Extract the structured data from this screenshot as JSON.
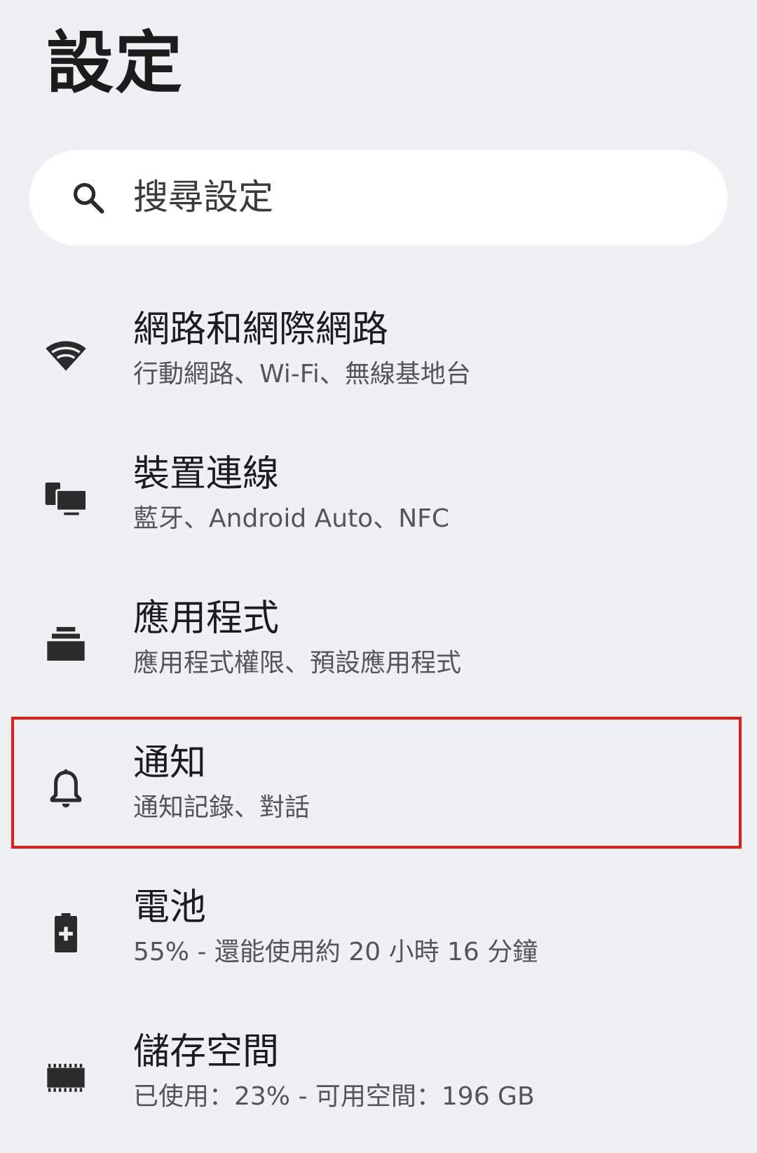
{
  "header": {
    "title": "設定"
  },
  "search": {
    "placeholder": "搜尋設定",
    "icon": "search-icon"
  },
  "settings": [
    {
      "id": "network",
      "icon": "wifi-icon",
      "title": "網路和網際網路",
      "summary": "行動網路、Wi-Fi、無線基地台"
    },
    {
      "id": "connected-devices",
      "icon": "devices-icon",
      "title": "裝置連線",
      "summary": "藍牙、Android Auto、NFC"
    },
    {
      "id": "apps",
      "icon": "apps-icon",
      "title": "應用程式",
      "summary": "應用程式權限、預設應用程式"
    },
    {
      "id": "notifications",
      "icon": "bell-icon",
      "title": "通知",
      "summary": "通知記錄、對話",
      "highlighted": true
    },
    {
      "id": "battery",
      "icon": "battery-icon",
      "title": "電池",
      "summary": "55% - 還能使用約 20 小時 16 分鐘"
    },
    {
      "id": "storage",
      "icon": "storage-icon",
      "title": "儲存空間",
      "summary": "已使用：23% - 可用空間：196 GB"
    }
  ],
  "colors": {
    "background": "#eff0f4",
    "search_background": "#ffffff",
    "icon": "#2b2b2b",
    "highlight": "#e21b1b"
  }
}
